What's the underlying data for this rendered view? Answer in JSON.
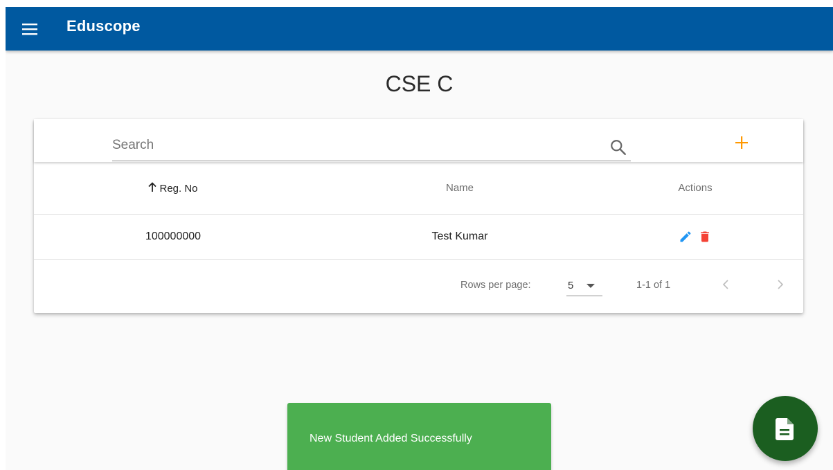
{
  "app": {
    "title": "Eduscope",
    "accent_color": "#0059a0"
  },
  "page": {
    "title": "CSE C"
  },
  "toolbar": {
    "search_placeholder": "Search",
    "search_value": "",
    "search_icon": "search-icon",
    "add_icon": "plus-icon",
    "add_color": "#ff9800"
  },
  "table": {
    "columns": [
      {
        "label": "Reg. No",
        "sorted": "ascending"
      },
      {
        "label": "Name"
      },
      {
        "label": "Actions"
      }
    ],
    "rows": [
      {
        "reg_no": "100000000",
        "name": "Test Kumar"
      }
    ],
    "action_icons": [
      "edit-icon",
      "delete-icon"
    ],
    "edit_color": "#2196f3",
    "delete_color": "#f44336"
  },
  "pagination": {
    "rows_per_page_label": "Rows per page:",
    "rows_per_page_value": "5",
    "range_text": "1-1 of 1"
  },
  "snackbar": {
    "message": "New Student Added Successfully",
    "color": "#4caf50"
  },
  "fab": {
    "icon": "document-icon",
    "color": "#1b5e20"
  }
}
